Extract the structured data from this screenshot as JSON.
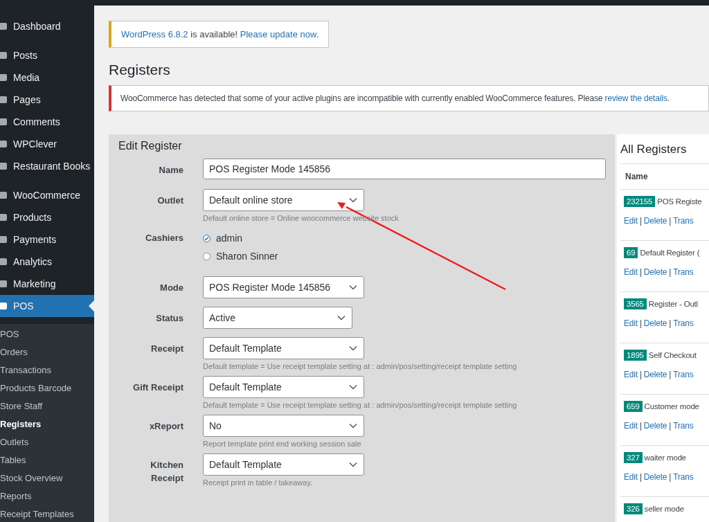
{
  "sidebar": {
    "menu_groups": [
      [
        {
          "label": "Dashboard",
          "current": false
        }
      ],
      [
        {
          "label": "Posts",
          "current": false
        },
        {
          "label": "Media",
          "current": false
        },
        {
          "label": "Pages",
          "current": false
        },
        {
          "label": "Comments",
          "current": false
        },
        {
          "label": "WPClever",
          "current": false
        },
        {
          "label": "Restaurant Books",
          "current": false
        }
      ],
      [
        {
          "label": "WooCommerce",
          "current": false
        },
        {
          "label": "Products",
          "current": false
        },
        {
          "label": "Payments",
          "current": false
        },
        {
          "label": "Analytics",
          "current": false
        },
        {
          "label": "Marketing",
          "current": false
        },
        {
          "label": "POS",
          "current": true
        }
      ]
    ],
    "submenu": [
      {
        "label": "POS",
        "selected": false
      },
      {
        "label": "Orders",
        "selected": false
      },
      {
        "label": "Transactions",
        "selected": false
      },
      {
        "label": "Products Barcode",
        "selected": false
      },
      {
        "label": "Store Staff",
        "selected": false
      },
      {
        "label": "Registers",
        "selected": true
      },
      {
        "label": "Outlets",
        "selected": false
      },
      {
        "label": "Tables",
        "selected": false
      },
      {
        "label": "Stock Overview",
        "selected": false
      },
      {
        "label": "Reports",
        "selected": false
      },
      {
        "label": "Receipt Templates",
        "selected": false
      }
    ]
  },
  "update_notice": {
    "link": "WordPress 6.8.2",
    "text": " is available! ",
    "action": "Please update now",
    "end": "."
  },
  "page_title": "Registers",
  "error_notice": {
    "text": "WooCommerce has detected that some of your active plugins are incompatible with currently enabled WooCommerce features. Please ",
    "link": "review the details",
    "end": "."
  },
  "edit_form": {
    "title": "Edit Register",
    "fields": [
      {
        "kind": "text",
        "label": "Name",
        "value": "POS Register Mode 145856"
      },
      {
        "kind": "select",
        "label": "Outlet",
        "value": "Default online store",
        "help": "Default online store = Online woocommerce website stock"
      },
      {
        "kind": "checkboxes",
        "label": "Cashiers",
        "options": [
          {
            "label": "admin",
            "checked": true
          },
          {
            "label": "Sharon Sinner",
            "checked": false
          }
        ]
      },
      {
        "kind": "select",
        "label": "Mode",
        "value": "POS Register Mode 145856"
      },
      {
        "kind": "select",
        "label": "Status",
        "value": "Active",
        "narrow": true
      },
      {
        "kind": "select",
        "label": "Receipt",
        "value": "Default Template",
        "help": "Default template = Use receipt template setting at : admin/pos/setting/receipt template setting"
      },
      {
        "kind": "select",
        "label": "Gift Receipt",
        "value": "Default Template",
        "help": "Default template = Use receipt template setting at : admin/pos/setting/receipt template setting"
      },
      {
        "kind": "select",
        "label": "xReport",
        "value": "No",
        "help": "Report template print end working session sale"
      },
      {
        "kind": "select",
        "label": "Kitchen Receipt",
        "value": "Default Template",
        "help": "Receipt print in table / takeaway."
      }
    ]
  },
  "all_registers": {
    "title": "All Registers",
    "column": "Name",
    "separator": "|",
    "rows": [
      {
        "id": "232155",
        "name": "POS Registe",
        "actions": [
          "Edit",
          "Delete",
          "Trans"
        ]
      },
      {
        "id": "69",
        "name": "Default Register (",
        "actions": [
          "Edit",
          "Delete",
          "Trans"
        ]
      },
      {
        "id": "3565",
        "name": "Register - Outl",
        "actions": [
          "Edit",
          "Delete",
          "Trans"
        ]
      },
      {
        "id": "1895",
        "name": "Self Checkout",
        "actions": [
          "Edit",
          "Delete",
          "Trans"
        ]
      },
      {
        "id": "659",
        "name": "Customer mode",
        "actions": [
          "Edit",
          "Delete",
          "Trans"
        ]
      },
      {
        "id": "327",
        "name": "waiter mode",
        "actions": [
          "Edit",
          "Delete",
          "Trans"
        ]
      },
      {
        "id": "326",
        "name": "seller mode",
        "actions": []
      }
    ]
  }
}
